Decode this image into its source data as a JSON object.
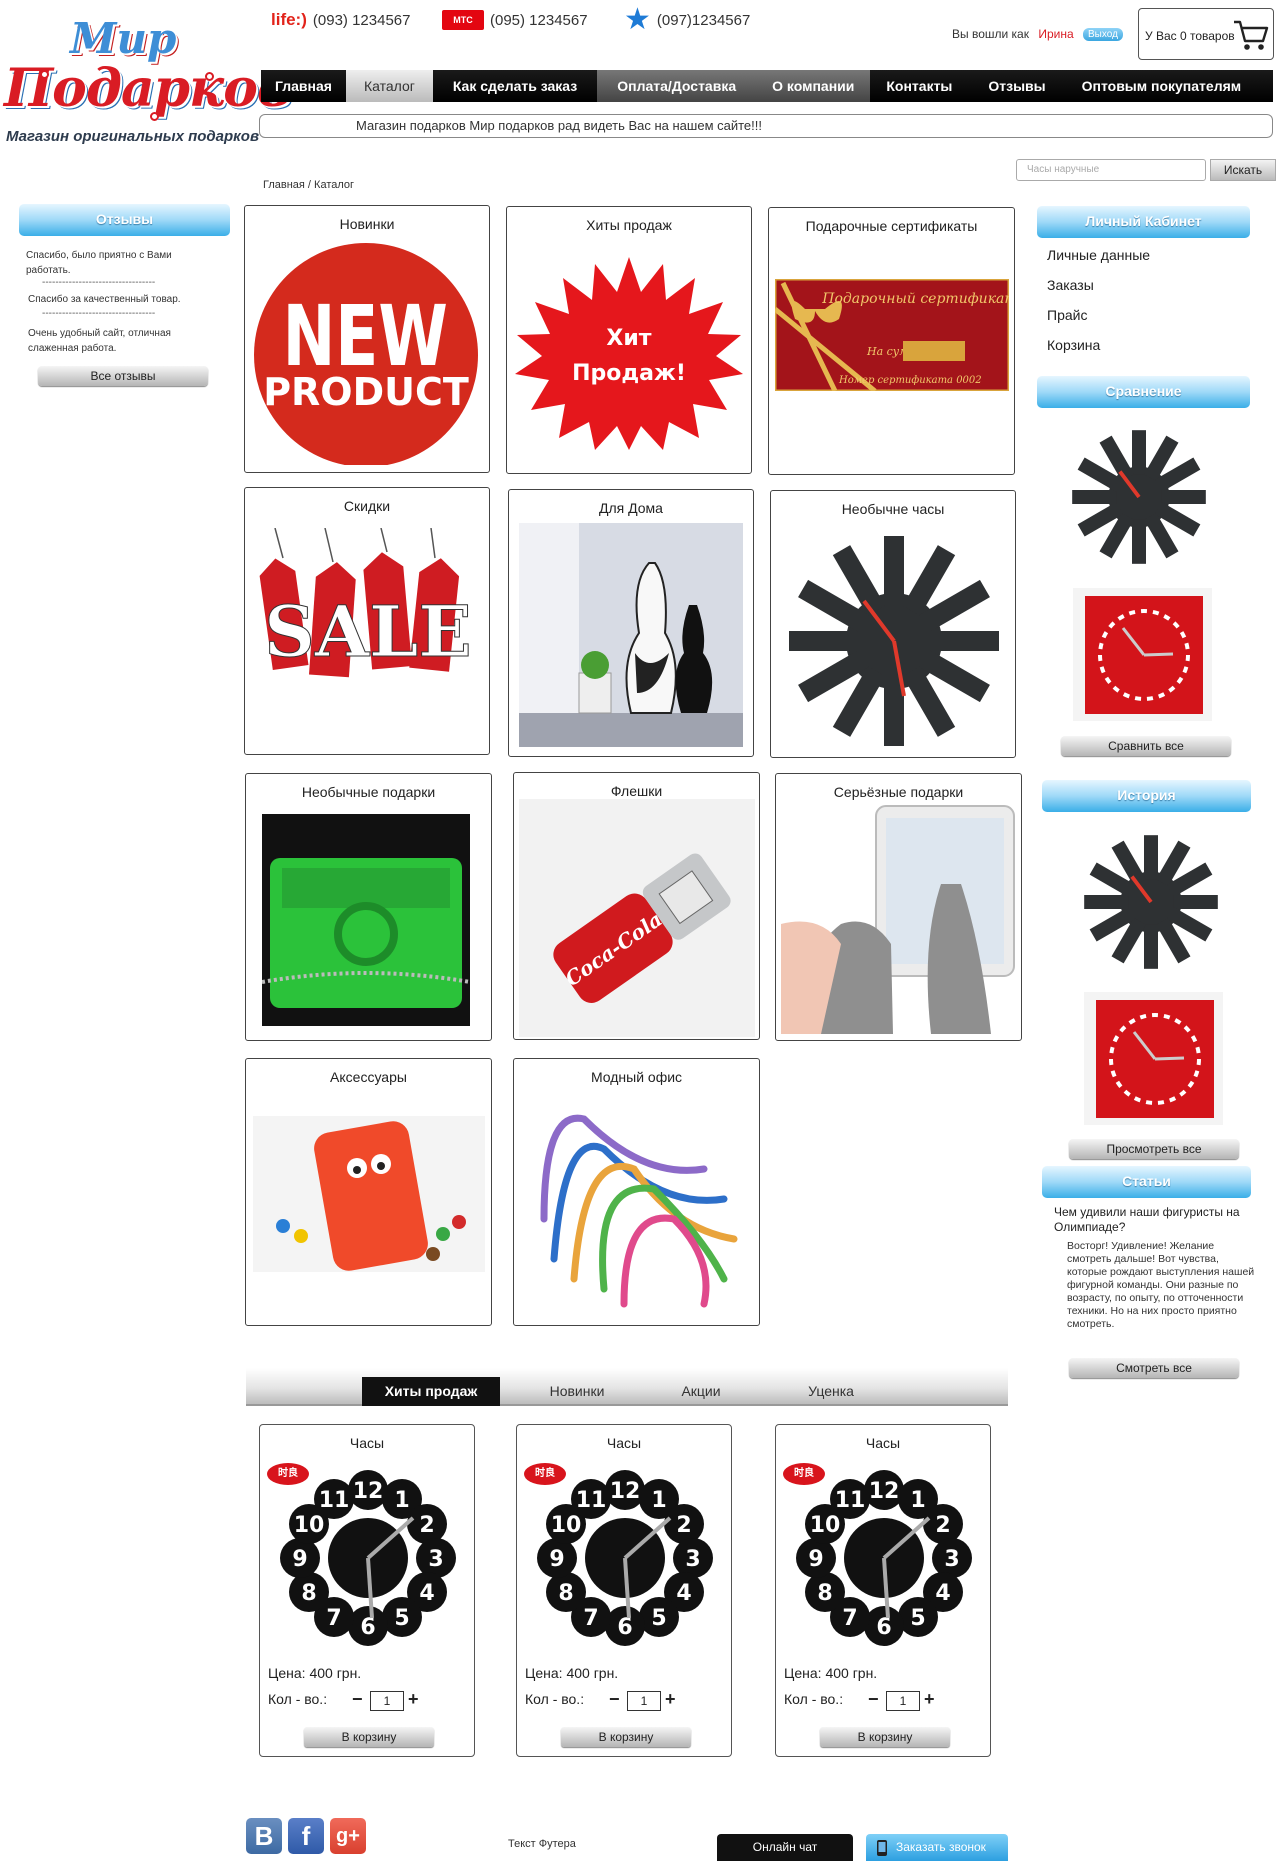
{
  "header": {
    "logo_top": "Мир",
    "logo_bottom": "Подарков",
    "tagline": "Магазин оригинальных подарков",
    "phones": [
      {
        "operator": "life:)",
        "number": "(093) 1234567"
      },
      {
        "operator": "МТС",
        "number": "(095) 1234567"
      },
      {
        "operator": "★",
        "number": "(097)1234567"
      }
    ],
    "login_text": "Вы вошли как",
    "login_user": "Ирина",
    "logout": "Выход",
    "cart_text": "У Вас 0 товаров"
  },
  "nav": {
    "items": [
      "Главная",
      "Каталог",
      "Как сделать заказ",
      "Оплата/Доставка",
      "О компании",
      "Контакты",
      "Отзывы",
      "Оптовым покупателям"
    ]
  },
  "welcome": "Магазин подарков Мир подарков рад видеть Вас на нашем сайте!!!",
  "search": {
    "placeholder": "Часы наручные",
    "button": "Искать"
  },
  "breadcrumb": "Главная / Каталог",
  "reviews": {
    "title": "Отзывы",
    "items": [
      "Спасибо, было приятно с Вами работать.",
      "Спасибо за качественный товар.",
      "Очень удобный сайт, отличная слаженная работа."
    ],
    "separator": "----------------------------------",
    "all_button": "Все отзывы"
  },
  "catalog": [
    {
      "title": "Новинки",
      "image": "new-product-badge"
    },
    {
      "title": "Хиты продаж",
      "image": "hit-sales-starburst",
      "badge_line1": "Хит",
      "badge_line2": "Продаж!"
    },
    {
      "title": "Подарочные сертификаты",
      "image": "gift-certificate",
      "cert_title": "Подарочный сертификат",
      "cert_sum": "На сумму",
      "cert_number": "Номер сертификата 0002"
    },
    {
      "title": "Скидки",
      "image": "sale-tags"
    },
    {
      "title": "Для Дома",
      "image": "home-vases"
    },
    {
      "title": "Необычне часы",
      "image": "unusual-clock"
    },
    {
      "title": "Необычные подарки",
      "image": "green-case"
    },
    {
      "title": "Флешки",
      "image": "coke-usb"
    },
    {
      "title": "Серьёзные подарки",
      "image": "tablet-gloves"
    },
    {
      "title": "Аксессуары",
      "image": "mm-phone-case"
    },
    {
      "title": "Модный офис",
      "image": "bent-pencils"
    }
  ],
  "sidebar_right": {
    "cabinet_title": "Личный Кабинет",
    "cabinet_links": [
      "Личные данные",
      "Заказы",
      "Прайс",
      "Корзина"
    ],
    "compare_title": "Сравнение",
    "compare_button": "Сравнить все",
    "history_title": "История",
    "history_button": "Просмотреть все",
    "articles_title": "Статьи",
    "article_heading": "Чем удивили наши фигуристы на Олимпиаде?",
    "article_text": "Восторг! Удивление! Желание смотреть дальше! Вот чувства, которые рождают выступления нашей фигурной команды. Они разные по возрасту, по опыту, по отточенности техники. Но на них просто приятно смотреть.",
    "article_button": "Смотреть все"
  },
  "tabs": [
    "Хиты продаж",
    "Новинки",
    "Акции",
    "Уценка"
  ],
  "products": [
    {
      "name": "Часы",
      "price": "Цена: 400 грн.",
      "qty_label": "Кол - во.:",
      "qty": "1",
      "buy": "В корзину",
      "brand": "时良"
    },
    {
      "name": "Часы",
      "price": "Цена: 400 грн.",
      "qty_label": "Кол - во.:",
      "qty": "1",
      "buy": "В корзину",
      "brand": "时良"
    },
    {
      "name": "Часы",
      "price": "Цена: 400 грн.",
      "qty_label": "Кол - во.:",
      "qty": "1",
      "buy": "В корзину",
      "brand": "时良"
    }
  ],
  "footer": {
    "social": [
      "B",
      "f",
      "g+"
    ],
    "text": "Текст Футера",
    "chat": "Онлайн чат",
    "call": "Заказать звонок"
  },
  "colors": {
    "brand_red": "#d91c24",
    "brand_blue": "#3aaee8",
    "menu_black": "#000000"
  }
}
